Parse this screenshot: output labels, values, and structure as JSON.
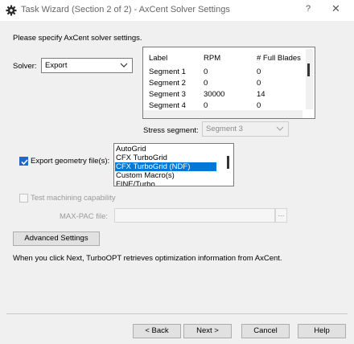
{
  "window": {
    "title": "Task Wizard (Section 2 of 2) - AxCent Solver Settings",
    "help_glyph": "?",
    "close_glyph": "✕"
  },
  "instructions": "Please specify AxCent solver settings.",
  "solver": {
    "label": "Solver:",
    "value": "Export"
  },
  "segment_table": {
    "headers": [
      "Label",
      "RPM",
      "# Full Blades"
    ],
    "rows": [
      [
        "Segment 1",
        "0",
        "0"
      ],
      [
        "Segment 2",
        "0",
        "0"
      ],
      [
        "Segment 3",
        "30000",
        "14"
      ],
      [
        "Segment 4",
        "0",
        "0"
      ]
    ]
  },
  "stress_segment": {
    "label": "Stress segment:",
    "value": "Segment 3"
  },
  "export_geometry": {
    "label": "Export geometry file(s):",
    "checked": true,
    "options": [
      "AutoGrid",
      "CFX TurboGrid",
      "CFX TurboGrid (NDF)",
      "Custom Macro(s)",
      "FINE/Turbo"
    ],
    "selected": "CFX TurboGrid (NDF)"
  },
  "test_machining": {
    "label": "Test machining capability",
    "checked": false
  },
  "max_pac": {
    "label": "MAX-PAC file:",
    "value": "",
    "browse_label": "..."
  },
  "advanced_settings_label": "Advanced Settings",
  "info_text": "When you click Next, TurboOPT retrieves optimization information from AxCent.",
  "buttons": {
    "back": "< Back",
    "next": "Next >",
    "cancel": "Cancel",
    "help": "Help"
  },
  "colors": {
    "accent": "#0078d7",
    "checkbox": "#1f68c8"
  }
}
